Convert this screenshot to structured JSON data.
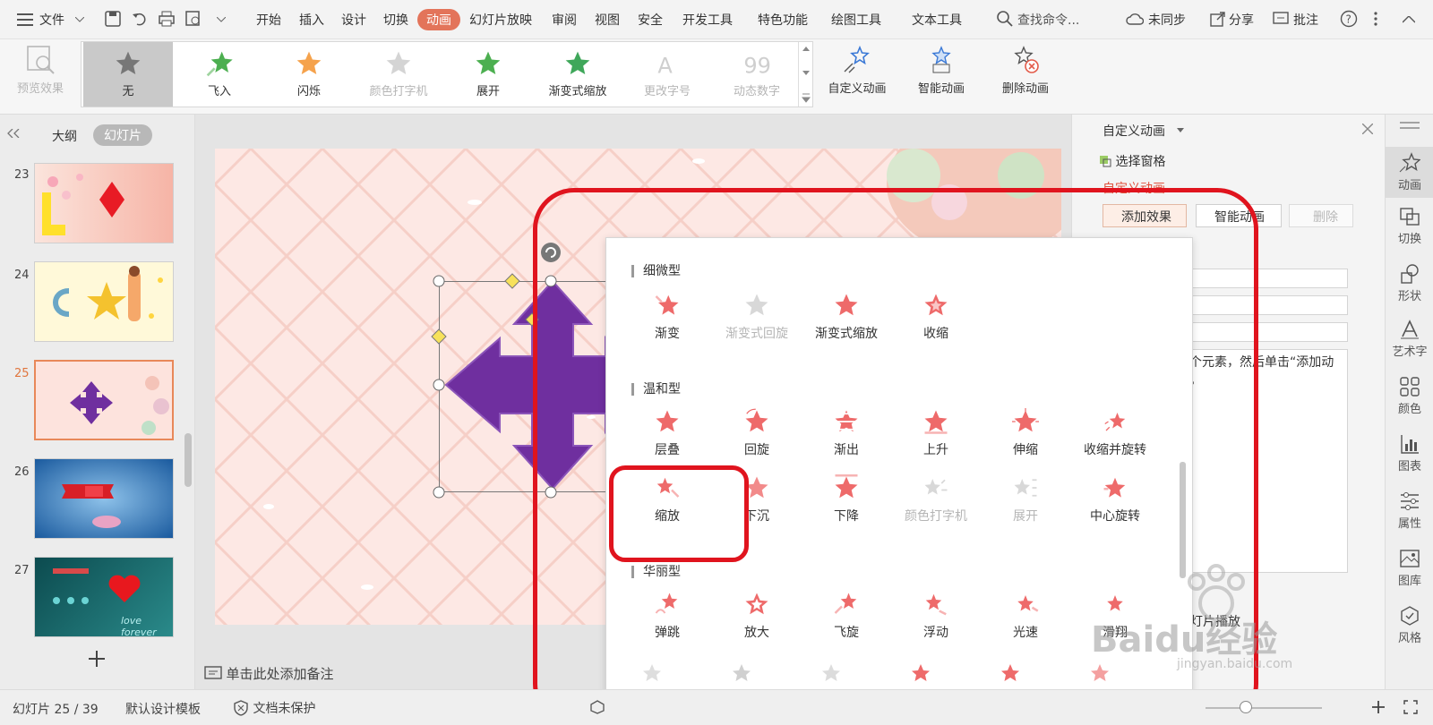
{
  "menubar": {
    "file": "文件",
    "tabs": [
      "开始",
      "插入",
      "设计",
      "切换",
      "动画",
      "幻灯片放映",
      "审阅",
      "视图",
      "安全",
      "开发工具",
      "特色功能",
      "绘图工具",
      "文本工具"
    ],
    "active_tab": "动画",
    "search": "查找命令...",
    "sync": "未同步",
    "share": "分享",
    "comment": "批注"
  },
  "ribbon": {
    "preview": "预览效果",
    "effects": [
      {
        "label": "无",
        "enabled": true
      },
      {
        "label": "飞入",
        "enabled": true
      },
      {
        "label": "闪烁",
        "enabled": true
      },
      {
        "label": "颜色打字机",
        "enabled": false
      },
      {
        "label": "展开",
        "enabled": true
      },
      {
        "label": "渐变式缩放",
        "enabled": true
      },
      {
        "label": "更改字号",
        "enabled": false
      },
      {
        "label": "动态数字",
        "enabled": false
      }
    ],
    "custom": "自定义动画",
    "smart": "智能动画",
    "delete": "删除动画"
  },
  "leftpanel": {
    "tab_outline": "大纲",
    "tab_slides": "幻灯片",
    "slides": [
      "23",
      "24",
      "25",
      "26",
      "27"
    ],
    "selected": "25",
    "thumb27_text": "love forever"
  },
  "slidearea": {
    "note_placeholder": "单击此处添加备注"
  },
  "rightpanel": {
    "title": "自定义动画",
    "select_pane": "选择窗格",
    "section": "自定义动画",
    "add_effect": "添加效果",
    "smart_anim": "智能动画",
    "delete": "删除",
    "hint_text": "某个元素，然后单击“添加动画。",
    "bottom_text": "幻灯片播放"
  },
  "rightbar": [
    "动画",
    "切换",
    "形状",
    "艺术字",
    "颜色",
    "图表",
    "属性",
    "图库",
    "风格"
  ],
  "popup": {
    "sections": [
      {
        "title": "细微型",
        "items": [
          {
            "label": "渐变",
            "enabled": true
          },
          {
            "label": "渐变式回旋",
            "enabled": false
          },
          {
            "label": "渐变式缩放",
            "enabled": true
          },
          {
            "label": "收缩",
            "enabled": true
          }
        ]
      },
      {
        "title": "温和型",
        "items": [
          {
            "label": "层叠",
            "enabled": true
          },
          {
            "label": "回旋",
            "enabled": true
          },
          {
            "label": "渐出",
            "enabled": true
          },
          {
            "label": "上升",
            "enabled": true
          },
          {
            "label": "伸缩",
            "enabled": true
          },
          {
            "label": "收缩并旋转",
            "enabled": true
          },
          {
            "label": "缩放",
            "enabled": true
          },
          {
            "label": "下沉",
            "enabled": true
          },
          {
            "label": "下降",
            "enabled": true
          },
          {
            "label": "颜色打字机",
            "enabled": false
          },
          {
            "label": "展开",
            "enabled": false
          },
          {
            "label": "中心旋转",
            "enabled": true
          }
        ]
      },
      {
        "title": "华丽型",
        "items": [
          {
            "label": "弹跳",
            "enabled": true
          },
          {
            "label": "放大",
            "enabled": true
          },
          {
            "label": "飞旋",
            "enabled": true
          },
          {
            "label": "浮动",
            "enabled": true
          },
          {
            "label": "光速",
            "enabled": true
          },
          {
            "label": "滑翔",
            "enabled": true
          }
        ]
      }
    ]
  },
  "statusbar": {
    "slide_count": "幻灯片 25 / 39",
    "template": "默认设计模板",
    "protect": "文档未保护"
  },
  "watermark": {
    "brand": "Baidu经验",
    "url": "jingyan.baidu.com"
  },
  "colors": {
    "accent": "#e3745a",
    "highlight_box": "#e0141e",
    "shape": "#6f2f9f",
    "star": "#ee6a6a"
  }
}
